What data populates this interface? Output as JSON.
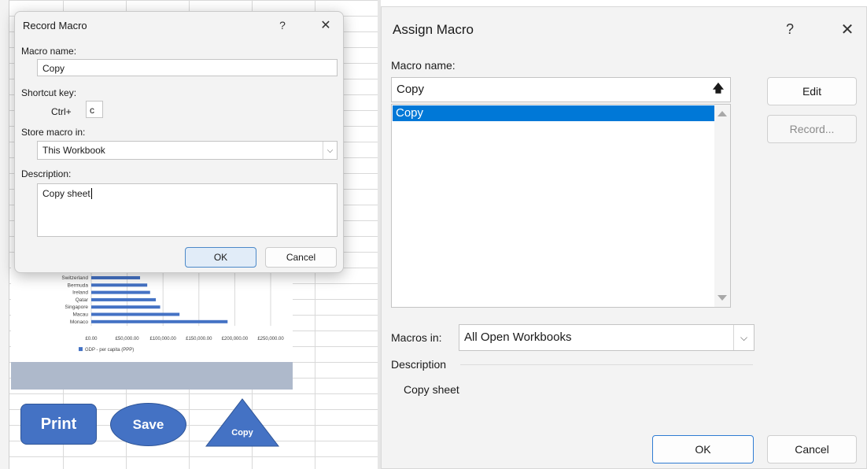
{
  "record_macro": {
    "title": "Record Macro",
    "help": "?",
    "close": "✕",
    "macro_name_label": "Macro name:",
    "macro_name_value": "Copy",
    "shortcut_label": "Shortcut key:",
    "ctrl_label": "Ctrl+",
    "shortcut_value": "c",
    "store_label": "Store macro in:",
    "store_value": "This Workbook",
    "description_label": "Description:",
    "description_value": "Copy sheet",
    "ok": "OK",
    "cancel": "Cancel"
  },
  "worksheet": {
    "chart": {
      "categories": [
        "Switzerland",
        "Bermuda",
        "Ireland",
        "Qatar",
        "Singapore",
        "Macau",
        "Monaco"
      ],
      "ticks": [
        "£0.00",
        "£50,000.00",
        "£100,000.00",
        "£150,000.00",
        "£200,000.00",
        "£250,000.00"
      ],
      "legend": "GDP - per capita (PPP)"
    },
    "buttons": {
      "print": "Print",
      "save": "Save",
      "copy": "Copy"
    }
  },
  "chart_data": {
    "type": "bar",
    "orientation": "horizontal",
    "categories": [
      "Switzerland",
      "Bermuda",
      "Ireland",
      "Qatar",
      "Singapore",
      "Macau",
      "Monaco"
    ],
    "series": [
      {
        "name": "GDP - per capita (PPP)",
        "values": [
          68000,
          78000,
          82000,
          90000,
          96000,
          123000,
          190000
        ]
      }
    ],
    "xlim": [
      0,
      250000
    ],
    "x_ticks": [
      "£0.00",
      "£50,000.00",
      "£100,000.00",
      "£150,000.00",
      "£200,000.00",
      "£250,000.00"
    ],
    "legend_position": "bottom",
    "color": "#4472c4"
  },
  "assign_macro": {
    "title": "Assign Macro",
    "help": "?",
    "close": "✕",
    "macro_name_label": "Macro name:",
    "macro_name_value": "Copy",
    "list_items": [
      "Copy"
    ],
    "edit": "Edit",
    "record": "Record...",
    "macros_in_label": "Macros in:",
    "macros_in_value": "All Open Workbooks",
    "description_label": "Description",
    "description_value": "Copy sheet",
    "ok": "OK",
    "cancel": "Cancel"
  },
  "colors": {
    "accent": "#0078d7",
    "shape_blue": "#4472c4",
    "ok_focus": "#e1ecf8"
  }
}
